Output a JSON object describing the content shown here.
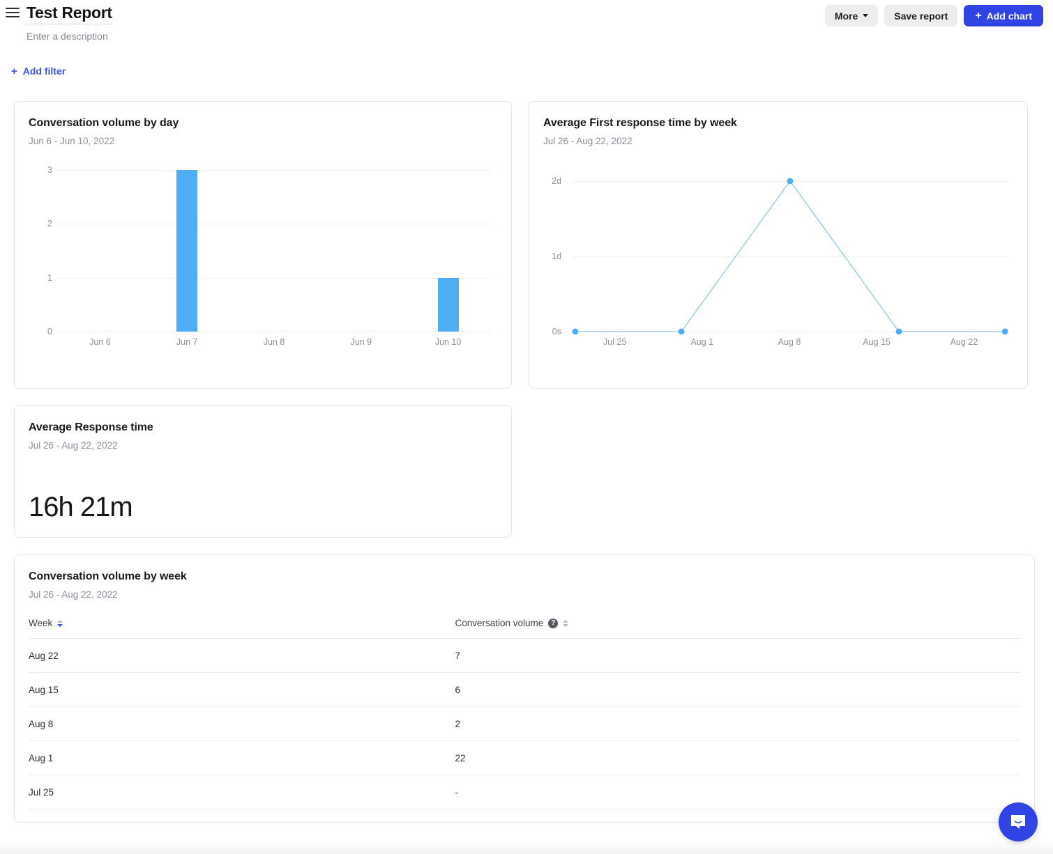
{
  "header": {
    "menu_icon": "hamburger-icon",
    "title": "Test Report",
    "description_placeholder": "Enter a description",
    "more_label": "More",
    "save_label": "Save report",
    "add_chart_label": "Add chart",
    "plus_glyph": "+",
    "add_filter_label": "Add filter"
  },
  "colors": {
    "accent_blue": "#2f44e3",
    "link_blue": "#3b52e8",
    "chart_blue": "#4fadf5",
    "card_border": "#e3e4e6",
    "muted_text": "#8a8f98"
  },
  "cards": {
    "bar_chart": {
      "title": "Conversation volume by day",
      "subtitle": "Jun 6 - Jun 10, 2022"
    },
    "line_chart": {
      "title": "Average First response time by week",
      "subtitle": "Jul 26 - Aug 22, 2022"
    },
    "metric": {
      "title": "Average Response time",
      "subtitle": "Jul 26 - Aug 22, 2022",
      "value": "16h 21m"
    },
    "table": {
      "title": "Conversation volume by week",
      "subtitle": "Jul 26 - Aug 22, 2022",
      "columns": [
        {
          "label": "Week",
          "sort": "desc"
        },
        {
          "label": "Conversation volume",
          "sort": "none",
          "help": "?"
        }
      ],
      "rows": [
        {
          "week": "Aug 22",
          "volume": "7"
        },
        {
          "week": "Aug 15",
          "volume": "6"
        },
        {
          "week": "Aug 8",
          "volume": "2"
        },
        {
          "week": "Aug 1",
          "volume": "22"
        },
        {
          "week": "Jul 25",
          "volume": "-"
        }
      ]
    }
  },
  "chat": {
    "icon": "chat-bubble-icon"
  },
  "chart_data": [
    {
      "type": "bar",
      "title": "Conversation volume by day",
      "subtitle": "Jun 6 - Jun 10, 2022",
      "categories": [
        "Jun 6",
        "Jun 7",
        "Jun 8",
        "Jun 9",
        "Jun 10"
      ],
      "values": [
        0,
        3,
        0,
        0,
        1
      ],
      "xlabel": "",
      "ylabel": "",
      "ylim": [
        0,
        3
      ],
      "yticks": [
        0,
        1,
        2,
        3
      ],
      "ytick_labels": [
        "0",
        "1",
        "2",
        "3"
      ],
      "grid": true,
      "legend": "none",
      "series_color": "#4fadf5"
    },
    {
      "type": "line",
      "title": "Average First response time by week",
      "subtitle": "Jul 26 - Aug 22, 2022",
      "categories": [
        "Jul 25",
        "Aug 1",
        "Aug 8",
        "Aug 15",
        "Aug 22"
      ],
      "values": [
        0,
        0,
        2.05,
        0,
        0
      ],
      "value_labels": [
        "0s",
        "0s",
        "2d",
        "0s",
        "0s"
      ],
      "xlabel": "",
      "ylabel": "",
      "ylim": [
        0,
        2.2
      ],
      "yticks": [
        0,
        1,
        2
      ],
      "ytick_labels": [
        "0s",
        "1d",
        "2d"
      ],
      "grid": true,
      "legend": "none",
      "markers": true,
      "series_color": "#4fadf5"
    },
    {
      "type": "table",
      "title": "Conversation volume by week",
      "subtitle": "Jul 26 - Aug 22, 2022",
      "categories": [
        "Week",
        "Conversation volume"
      ],
      "rows": [
        [
          "Aug 22",
          "7"
        ],
        [
          "Aug 15",
          "6"
        ],
        [
          "Aug 8",
          "2"
        ],
        [
          "Aug 1",
          "22"
        ],
        [
          "Jul 25",
          "-"
        ]
      ]
    }
  ]
}
